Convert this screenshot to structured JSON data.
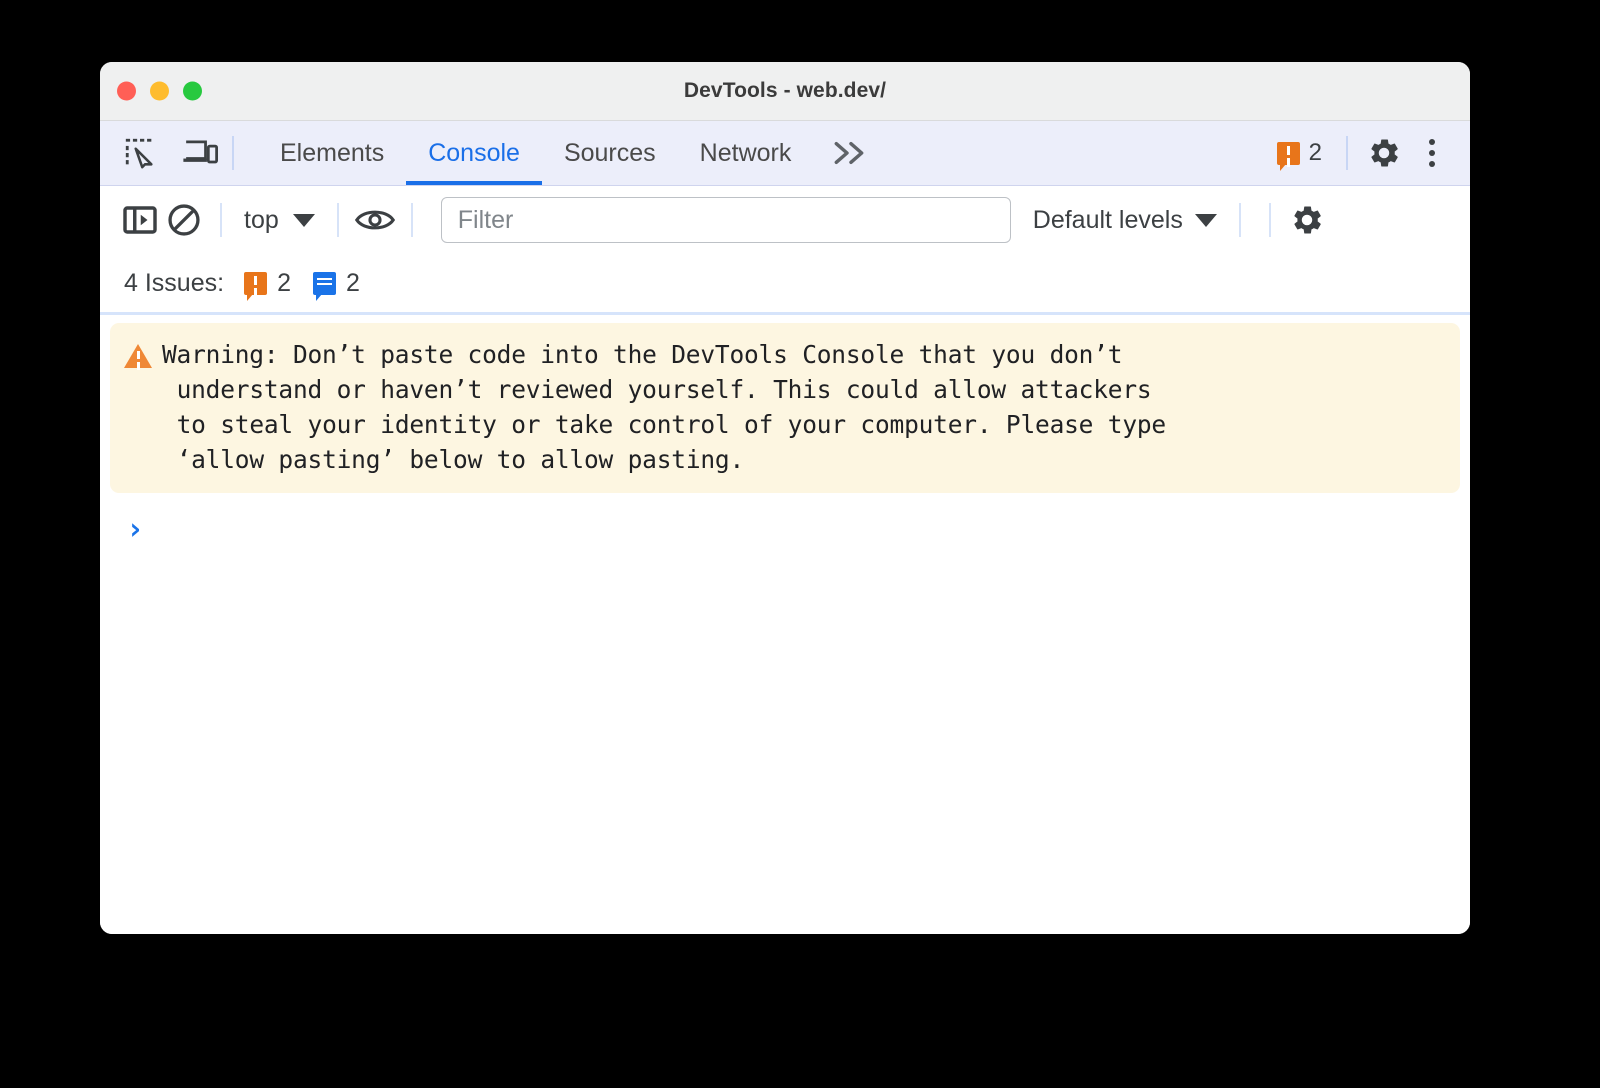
{
  "window": {
    "title": "DevTools - web.dev/",
    "traffic_lights": [
      {
        "name": "close",
        "color": "#ff5f56"
      },
      {
        "name": "minimize",
        "color": "#febc2e"
      },
      {
        "name": "maximize",
        "color": "#27c93f"
      }
    ]
  },
  "tabbar": {
    "inspect_icon": "inspect-element-icon",
    "device_icon": "device-toolbar-icon",
    "tabs": [
      {
        "label": "Elements",
        "active": false
      },
      {
        "label": "Console",
        "active": true
      },
      {
        "label": "Sources",
        "active": false
      },
      {
        "label": "Network",
        "active": false
      }
    ],
    "more_tabs_label": "»",
    "warning_count": "2",
    "settings_icon": "gear-icon",
    "more_options_icon": "three-dot-menu-icon",
    "accent_color": "#1a6fe8"
  },
  "console_toolbar": {
    "sidebar_toggle_icon": "console-sidebar-icon",
    "clear_console_icon": "clear-console-icon",
    "context_selector": "top",
    "live_expression_icon": "eye-icon",
    "filter": {
      "placeholder": "Filter",
      "value": ""
    },
    "log_levels": "Default levels",
    "settings_icon": "gear-icon"
  },
  "issues_bar": {
    "label": "4 Issues:",
    "groups": [
      {
        "icon": "warning-bubble-icon",
        "count": "2",
        "color": "#e8751a"
      },
      {
        "icon": "info-bubble-icon",
        "count": "2",
        "color": "#1a73e8"
      }
    ]
  },
  "console_body": {
    "warning": {
      "icon": "warning-triangle-icon",
      "background": "#fdf6e1",
      "text": "Warning: Don’t paste code into the DevTools Console that you don’t\n understand or haven’t reviewed yourself. This could allow attackers\n to steal your identity or take control of your computer. Please type\n ‘allow pasting’ below to allow pasting."
    },
    "prompt": {
      "chevron": "›",
      "value": ""
    }
  }
}
